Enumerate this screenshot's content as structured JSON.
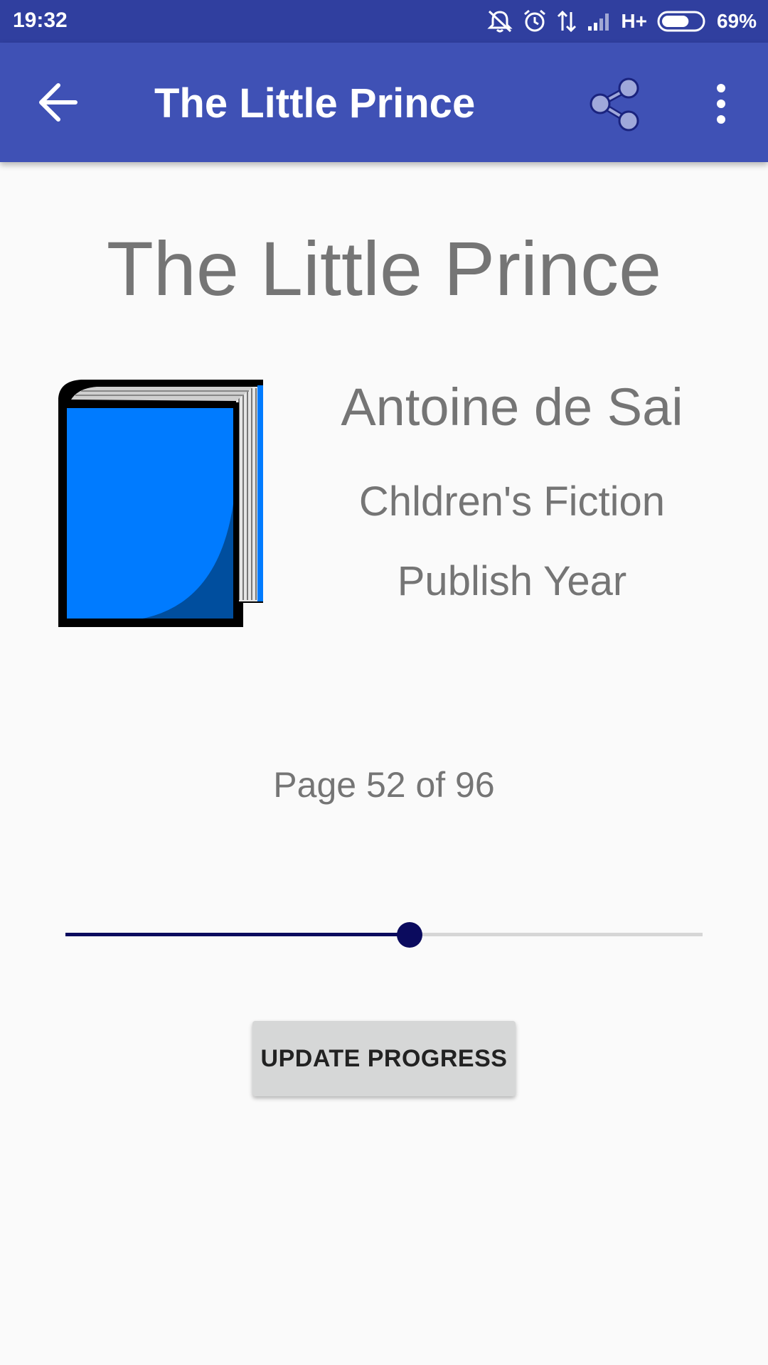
{
  "status_bar": {
    "time": "19:32",
    "network_label": "H+",
    "battery_percent": "69%",
    "battery_level": 0.69,
    "icons": [
      "mute-vibrate-icon",
      "alarm-icon",
      "data-transfer-icon",
      "signal-icon",
      "battery-icon"
    ]
  },
  "app_bar": {
    "title": "The Little Prince",
    "back_icon": "arrow-back-icon",
    "share_icon": "share-icon",
    "more_icon": "more-vert-icon",
    "color": "#3F51B5",
    "status_color": "#303F9F"
  },
  "book": {
    "title": "The Little Prince",
    "author": "Antoine de Sai",
    "genre": "Chldren's Fiction",
    "publish_year": "Publish Year",
    "cover_icon": "book-icon",
    "cover_color": "#007BFF"
  },
  "progress": {
    "page_text": "Page 52 of 96",
    "current_page": 52,
    "total_pages": 96,
    "seek_fraction": 0.54,
    "accent_color": "#0B0B5E"
  },
  "actions": {
    "update_label": "UPDATE PROGRESS"
  }
}
